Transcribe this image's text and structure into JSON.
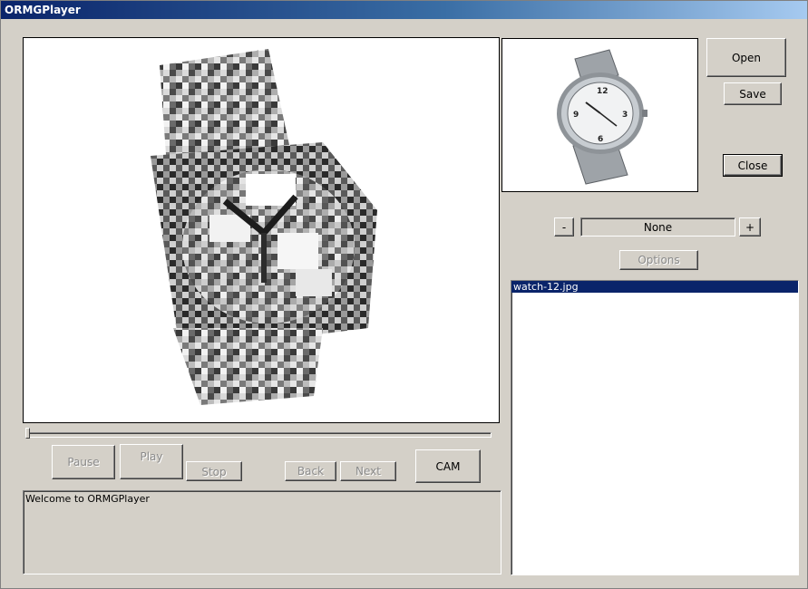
{
  "window": {
    "title": "ORMGPlayer"
  },
  "buttons": {
    "open": "Open",
    "save": "Save",
    "close": "Close",
    "minus": "-",
    "plus": "+",
    "options": "Options",
    "pause": "Pause",
    "play": "Play",
    "stop": "Stop",
    "back": "Back",
    "next": "Next",
    "cam": "CAM"
  },
  "filter": {
    "selected": "None"
  },
  "filelist": {
    "items": [
      "watch-12.jpg"
    ],
    "selected_index": 0
  },
  "log": {
    "text": "Welcome to ORMGPlayer"
  },
  "playback": {
    "position": 0
  }
}
